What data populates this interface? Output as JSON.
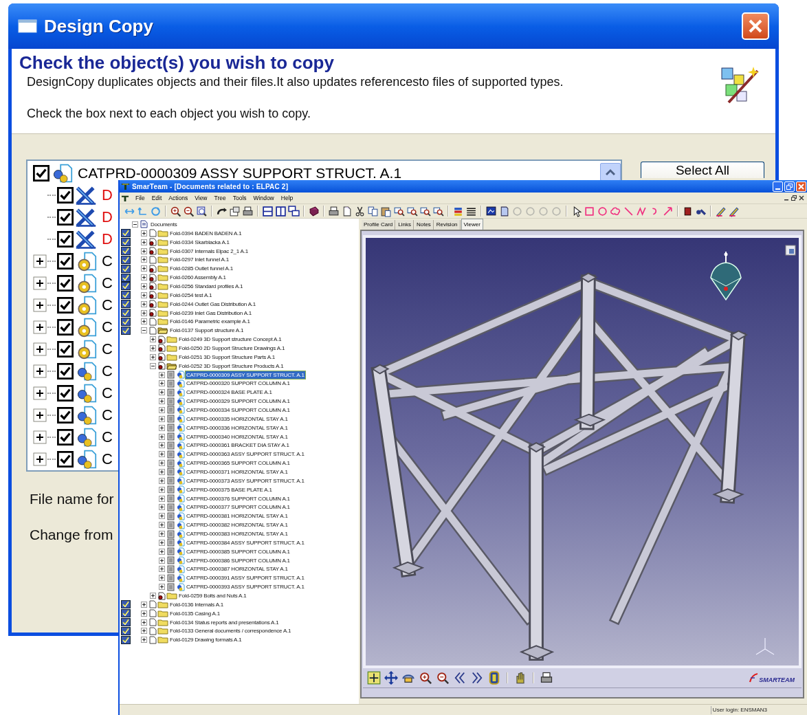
{
  "design_copy": {
    "title": "Design Copy",
    "heading": "Check the object(s) you wish to copy",
    "description": "DesignCopy duplicates objects and their files.It also updates referencesto files of supported types.",
    "instruction": "Check the box next to each object you wish to copy.",
    "tree": [
      {
        "kind": "assembly",
        "label": "CATPRD-0000309 ASSY SUPPORT STRUCT. A.1",
        "checked": true,
        "children": [
          {
            "kind": "drawing",
            "label": "D",
            "checked": true
          },
          {
            "kind": "drawing",
            "label": "D",
            "checked": true
          },
          {
            "kind": "drawing",
            "label": "D",
            "checked": true
          },
          {
            "kind": "part",
            "label": "C",
            "checked": true,
            "expanded": false
          },
          {
            "kind": "part",
            "label": "C",
            "checked": true,
            "expanded": false
          },
          {
            "kind": "part",
            "label": "C",
            "checked": true,
            "expanded": false
          },
          {
            "kind": "part",
            "label": "C",
            "checked": true,
            "expanded": false
          },
          {
            "kind": "part",
            "label": "C",
            "checked": true,
            "expanded": false
          },
          {
            "kind": "assembly",
            "label": "C",
            "checked": true,
            "expanded": false
          },
          {
            "kind": "assembly",
            "label": "C",
            "checked": true,
            "expanded": false
          },
          {
            "kind": "assembly",
            "label": "C",
            "checked": true,
            "expanded": false
          },
          {
            "kind": "assembly",
            "label": "C",
            "checked": true,
            "expanded": false
          },
          {
            "kind": "assembly",
            "label": "C",
            "checked": true,
            "expanded": false
          }
        ]
      }
    ],
    "select_all_button": "Select All",
    "file_name_label": "File name for",
    "change_from_label": "Change from"
  },
  "smarteam": {
    "title": "SmarTeam - [Documents related to : ELPAC 2]",
    "menu": [
      "File",
      "Edit",
      "Actions",
      "View",
      "Tree",
      "Tools",
      "Window",
      "Help"
    ],
    "tree": [
      {
        "kind": "root",
        "label": "Documents",
        "expanded": true,
        "selected": false,
        "children": [
          {
            "kind": "folder",
            "label": "Fold-0394 BADEN BADEN A.1",
            "checked_out": false,
            "expanded": false,
            "selected": false
          },
          {
            "kind": "folder",
            "label": "Fold-0334 Skarblacka A.1",
            "checked_out": true,
            "expanded": false,
            "selected": false
          },
          {
            "kind": "folder",
            "label": "Fold-0307 Internals Elpac 2_1 A.1",
            "checked_out": true,
            "expanded": false,
            "selected": false
          },
          {
            "kind": "folder",
            "label": "Fold-0297 Inlet funnel A.1",
            "checked_out": false,
            "expanded": false,
            "selected": false
          },
          {
            "kind": "folder",
            "label": "Fold-0285 Outlet funnel A.1",
            "checked_out": true,
            "expanded": false,
            "selected": false
          },
          {
            "kind": "folder",
            "label": "Fold-0260 Assembly A.1",
            "checked_out": true,
            "expanded": false,
            "selected": false
          },
          {
            "kind": "folder",
            "label": "Fold-0256 Standard profiles A.1",
            "checked_out": true,
            "expanded": false,
            "selected": false
          },
          {
            "kind": "folder",
            "label": "Fold-0254 test A.1",
            "checked_out": true,
            "expanded": false,
            "selected": false
          },
          {
            "kind": "folder",
            "label": "Fold-0244 Outlet Gas Distribution A.1",
            "checked_out": true,
            "expanded": false,
            "selected": false
          },
          {
            "kind": "folder",
            "label": "Fold-0239 Inlet Gas Distribution A.1",
            "checked_out": true,
            "expanded": false,
            "selected": false
          },
          {
            "kind": "folder",
            "label": "Fold-0146 Parametric example A.1",
            "checked_out": false,
            "expanded": false,
            "selected": false
          },
          {
            "kind": "folder",
            "label": "Fold-0137 Support structure A.1",
            "checked_out": false,
            "expanded": true,
            "selected": false,
            "children": [
              {
                "kind": "folder",
                "label": "Fold-0249 3D Support structure Concept A.1",
                "checked_out": true,
                "expanded": false,
                "selected": false
              },
              {
                "kind": "folder",
                "label": "Fold-0250 2D Support Structure Drawings A.1",
                "checked_out": true,
                "expanded": false,
                "selected": false
              },
              {
                "kind": "folder",
                "label": "Fold-0251 3D Support Structure Parts A.1",
                "checked_out": true,
                "expanded": false,
                "selected": false
              },
              {
                "kind": "folder",
                "label": "Fold-0252 3D Support Structure Products A.1",
                "checked_out": true,
                "expanded": true,
                "selected": false,
                "children": [
                  {
                    "kind": "product",
                    "label": "CATPRD-0000309 ASSY SUPPORT STRUCT. A.1",
                    "expanded": false,
                    "selected": true
                  },
                  {
                    "kind": "product",
                    "label": "CATPRD-0000320 SUPPORT COLUMN A.1",
                    "expanded": false,
                    "selected": false
                  },
                  {
                    "kind": "product",
                    "label": "CATPRD-0000324 BASE PLATE A.1",
                    "expanded": false,
                    "selected": false
                  },
                  {
                    "kind": "product",
                    "label": "CATPRD-0000329 SUPPORT COLUMN A.1",
                    "expanded": false,
                    "selected": false
                  },
                  {
                    "kind": "product",
                    "label": "CATPRD-0000334 SUPPORT COLUMN A.1",
                    "expanded": false,
                    "selected": false
                  },
                  {
                    "kind": "product",
                    "label": "CATPRD-0000335 HORIZONTAL STAY A.1",
                    "expanded": false,
                    "selected": false
                  },
                  {
                    "kind": "product",
                    "label": "CATPRD-0000336 HORIZONTAL STAY A.1",
                    "expanded": false,
                    "selected": false
                  },
                  {
                    "kind": "product",
                    "label": "CATPRD-0000340 HORIZONTAL STAY A.1",
                    "expanded": false,
                    "selected": false
                  },
                  {
                    "kind": "product",
                    "label": "CATPRD-0000361 BRACKET DIA STAY A.1",
                    "expanded": false,
                    "selected": false
                  },
                  {
                    "kind": "product",
                    "label": "CATPRD-0000363 ASSY SUPPORT STRUCT. A.1",
                    "expanded": false,
                    "selected": false
                  },
                  {
                    "kind": "product",
                    "label": "CATPRD-0000365 SUPPORT COLUMN A.1",
                    "expanded": false,
                    "selected": false
                  },
                  {
                    "kind": "product",
                    "label": "CATPRD-0000371 HORIZONTAL STAY A.1",
                    "expanded": false,
                    "selected": false
                  },
                  {
                    "kind": "product",
                    "label": "CATPRD-0000373 ASSY SUPPORT STRUCT. A.1",
                    "expanded": false,
                    "selected": false
                  },
                  {
                    "kind": "product",
                    "label": "CATPRD-0000375 BASE PLATE A.1",
                    "expanded": false,
                    "selected": false
                  },
                  {
                    "kind": "product",
                    "label": "CATPRD-0000376 SUPPORT COLUMN A.1",
                    "expanded": false,
                    "selected": false
                  },
                  {
                    "kind": "product",
                    "label": "CATPRD-0000377 SUPPORT COLUMN A.1",
                    "expanded": false,
                    "selected": false
                  },
                  {
                    "kind": "product",
                    "label": "CATPRD-0000381 HORIZONTAL STAY A.1",
                    "expanded": false,
                    "selected": false
                  },
                  {
                    "kind": "product",
                    "label": "CATPRD-0000382 HORIZONTAL STAY A.1",
                    "expanded": false,
                    "selected": false
                  },
                  {
                    "kind": "product",
                    "label": "CATPRD-0000383 HORIZONTAL STAY A.1",
                    "expanded": false,
                    "selected": false
                  },
                  {
                    "kind": "product",
                    "label": "CATPRD-0000384 ASSY SUPPORT STRUCT. A.1",
                    "expanded": false,
                    "selected": false
                  },
                  {
                    "kind": "product",
                    "label": "CATPRD-0000385 SUPPORT COLUMN A.1",
                    "expanded": false,
                    "selected": false
                  },
                  {
                    "kind": "product",
                    "label": "CATPRD-0000386 SUPPORT COLUMN A.1",
                    "expanded": false,
                    "selected": false
                  },
                  {
                    "kind": "product",
                    "label": "CATPRD-0000387 HORIZONTAL STAY A.1",
                    "expanded": false,
                    "selected": false
                  },
                  {
                    "kind": "product",
                    "label": "CATPRD-0000391 ASSY SUPPORT STRUCT. A.1",
                    "expanded": false,
                    "selected": false
                  },
                  {
                    "kind": "product",
                    "label": "CATPRD-0000393 ASSY SUPPORT STRUCT. A.1",
                    "expanded": false,
                    "selected": false
                  }
                ]
              },
              {
                "kind": "folder",
                "label": "Fold-0259 Bolts and Nuts A.1",
                "checked_out": true,
                "expanded": false,
                "selected": false
              }
            ]
          },
          {
            "kind": "folder",
            "label": "Fold-0136 Internals A.1",
            "checked_out": false,
            "expanded": false,
            "selected": false
          },
          {
            "kind": "folder",
            "label": "Fold-0135 Casing A.1",
            "checked_out": false,
            "expanded": false,
            "selected": false
          },
          {
            "kind": "folder",
            "label": "Fold-0134 Status reports and presentations A.1",
            "checked_out": false,
            "expanded": false,
            "selected": false
          },
          {
            "kind": "folder",
            "label": "Fold-0133 General documents / correspondence A.1",
            "checked_out": false,
            "expanded": false,
            "selected": false
          },
          {
            "kind": "folder",
            "label": "Fold-0129 Drawing formats A.1",
            "checked_out": false,
            "expanded": false,
            "selected": false
          }
        ]
      }
    ],
    "tabs": [
      {
        "label": "Profile Card",
        "selected": false
      },
      {
        "label": "Links",
        "selected": false
      },
      {
        "label": "Notes",
        "selected": false
      },
      {
        "label": "Revision",
        "selected": false
      },
      {
        "label": "Viewer",
        "selected": true
      }
    ],
    "logo": "SMARTEAM",
    "status_bar": {
      "user_login": "User login: ENSMAN3"
    }
  }
}
